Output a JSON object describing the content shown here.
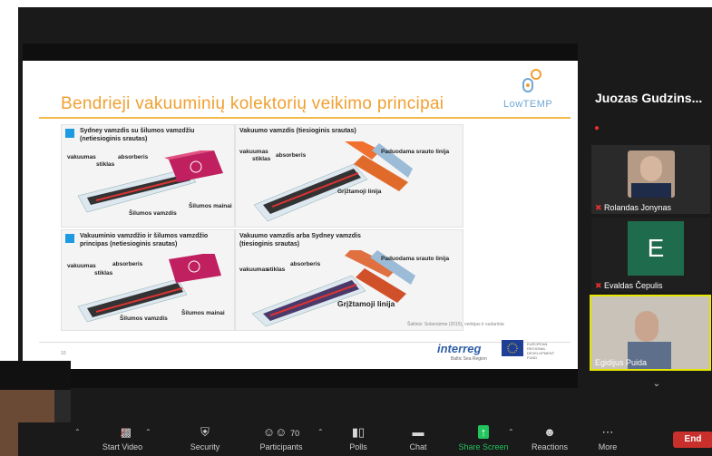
{
  "slide": {
    "title": "Bendrieji vakuuminių kolektorių veikimo principai",
    "logo_text": "LowTEMP",
    "panels": [
      {
        "caption": "Sydney vamzdis su šilumos vamzdžiu (netiesioginis srautas)",
        "labels": [
          "vakuumas",
          "stiklas",
          "absorberis",
          "Šilumos mainai",
          "Šilumos vamzdis"
        ]
      },
      {
        "caption": "Vakuumo vamzdis (tiesioginis srautas)",
        "labels": [
          "vakuumas",
          "stiklas",
          "absorberis",
          "Paduodama srauto linija",
          "Grįžtamoji linija"
        ]
      },
      {
        "caption": "Vakuuminio vamzdžio ir šilumos vamzdžio principas (netiesioginis srautas)",
        "labels": [
          "vakuumas",
          "stiklas",
          "absorberis",
          "Šilumos vamzdis",
          "Šilumos mainai"
        ]
      },
      {
        "caption": "Vakuumo vamzdis arba Sydney vamzdis (tiesioginis srautas)",
        "labels": [
          "vakuumas",
          "stiklas",
          "absorberis",
          "Paduodama srauto linija",
          "Grįžtamoji linija"
        ]
      }
    ],
    "source": "Šaltinis: Solarvärme (2015), vertėjas ir sudarinta",
    "slide_number": "10",
    "interreg": "interreg",
    "interreg_sub": "Baltic Sea Region",
    "eu_text": "EUROPEAN REGIONAL DEVELOPMENT FUND"
  },
  "participants": {
    "active_speaker": "Juozas  Gudzins...",
    "p1": "Rolandas Jonynas",
    "p2_initial": "E",
    "p2": "Evaldas Čepulis",
    "p3": "Egidijus Puida"
  },
  "toolbar": {
    "items": [
      {
        "label": "Start Video",
        "icon": "video-off-icon"
      },
      {
        "label": "Security",
        "icon": "shield-icon"
      },
      {
        "label": "Participants",
        "icon": "participants-icon",
        "count": "70"
      },
      {
        "label": "Polls",
        "icon": "polls-icon"
      },
      {
        "label": "Chat",
        "icon": "chat-icon"
      },
      {
        "label": "Share Screen",
        "icon": "share-screen-icon"
      },
      {
        "label": "Reactions",
        "icon": "reactions-icon"
      },
      {
        "label": "More",
        "icon": "more-icon"
      }
    ],
    "end_label": "End"
  },
  "colors": {
    "accent_title": "#f0a030",
    "share_green": "#21c45d",
    "end_red": "#c9302c",
    "panel_blue": "#1e9be0"
  }
}
